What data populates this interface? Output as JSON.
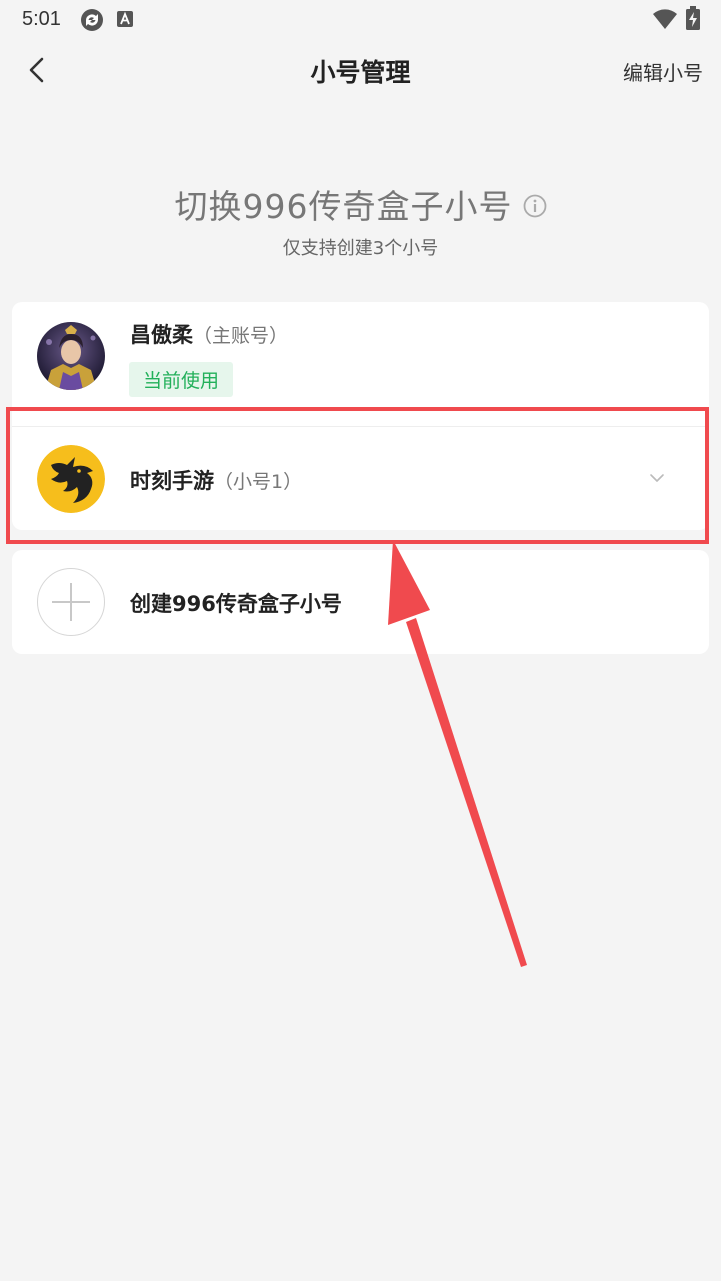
{
  "status_bar": {
    "time": "5:01",
    "icons": [
      "sync-icon",
      "keyboard-a-icon",
      "wifi-icon",
      "battery-charging-icon"
    ]
  },
  "header": {
    "title": "小号管理",
    "edit_label": "编辑小号",
    "back_icon": "chevron-left-icon"
  },
  "switch_section": {
    "title": "切换996传奇盒子小号",
    "info_icon": "info-icon",
    "subtitle": "仅支持创建3个小号"
  },
  "accounts": [
    {
      "name": "昌傲柔",
      "tag": "（主账号）",
      "badge": "当前使用",
      "avatar_icon": "game-character-avatar"
    },
    {
      "name": "时刻手游",
      "tag": "（小号1）",
      "avatar_icon": "yellow-dragon-logo"
    }
  ],
  "create_account": {
    "label": "创建996传奇盒子小号",
    "icon": "plus-icon"
  },
  "colors": {
    "background": "#f4f4f4",
    "badge_green": "#22b05a",
    "badge_bg": "#e6f6ec",
    "annotation_red": "#f04a4e",
    "dragon_yellow": "#f6be1c"
  }
}
